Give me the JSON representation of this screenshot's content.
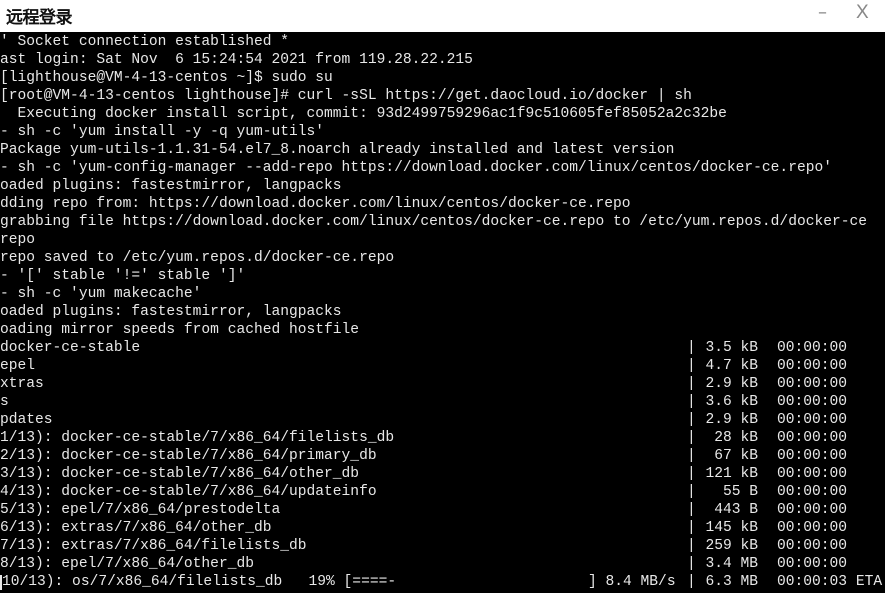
{
  "window": {
    "title": "远程登录",
    "minimize_label": "–",
    "close_label": "X"
  },
  "terminal": {
    "lines": [
      "' Socket connection established *",
      "ast login: Sat Nov  6 15:24:54 2021 from 119.28.22.215",
      "[lighthouse@VM-4-13-centos ~]$ sudo su",
      "[root@VM-4-13-centos lighthouse]# curl -sSL https://get.daocloud.io/docker | sh",
      "  Executing docker install script, commit: 93d2499759296ac1f9c510605fef85052a2c32be",
      "- sh -c 'yum install -y -q yum-utils'",
      "Package yum-utils-1.1.31-54.el7_8.noarch already installed and latest version",
      "- sh -c 'yum-config-manager --add-repo https://download.docker.com/linux/centos/docker-ce.repo'",
      "oaded plugins: fastestmirror, langpacks",
      "dding repo from: https://download.docker.com/linux/centos/docker-ce.repo",
      "grabbing file https://download.docker.com/linux/centos/docker-ce.repo to /etc/yum.repos.d/docker-ce",
      "repo",
      "repo saved to /etc/yum.repos.d/docker-ce.repo",
      "- '[' stable '!=' stable ']'",
      "- sh -c 'yum makecache'",
      "oaded plugins: fastestmirror, langpacks",
      "oading mirror speeds from cached hostfile"
    ],
    "rows": [
      {
        "name": "docker-ce-stable",
        "size": "3.5 kB",
        "time": "00:00:00"
      },
      {
        "name": "epel",
        "size": "4.7 kB",
        "time": "00:00:00"
      },
      {
        "name": "xtras",
        "size": "2.9 kB",
        "time": "00:00:00"
      },
      {
        "name": "s",
        "size": "3.6 kB",
        "time": "00:00:00"
      },
      {
        "name": "pdates",
        "size": "2.9 kB",
        "time": "00:00:00"
      },
      {
        "name": "1/13): docker-ce-stable/7/x86_64/filelists_db",
        "size": "28 kB",
        "time": "00:00:00"
      },
      {
        "name": "2/13): docker-ce-stable/7/x86_64/primary_db",
        "size": "67 kB",
        "time": "00:00:00"
      },
      {
        "name": "3/13): docker-ce-stable/7/x86_64/other_db",
        "size": "121 kB",
        "time": "00:00:00"
      },
      {
        "name": "4/13): docker-ce-stable/7/x86_64/updateinfo",
        "size": "55 B",
        "time": "00:00:00"
      },
      {
        "name": "5/13): epel/7/x86_64/prestodelta",
        "size": "443 B",
        "time": "00:00:00"
      },
      {
        "name": "6/13): extras/7/x86_64/other_db",
        "size": "145 kB",
        "time": "00:00:00"
      },
      {
        "name": "7/13): extras/7/x86_64/filelists_db",
        "size": "259 kB",
        "time": "00:00:00"
      },
      {
        "name": "8/13): epel/7/x86_64/other_db",
        "size": "3.4 MB",
        "time": "00:00:00"
      }
    ],
    "progress": {
      "name": "10/13): os/7/x86_64/filelists_db   19% [====-",
      "percent": 19,
      "speed": "] 8.4 MB/s",
      "size": "6.3 MB",
      "time": "00:00:03 ETA"
    },
    "pipe": "|",
    "colors": {
      "background": "#000000",
      "text": "#e8e8e8"
    }
  }
}
